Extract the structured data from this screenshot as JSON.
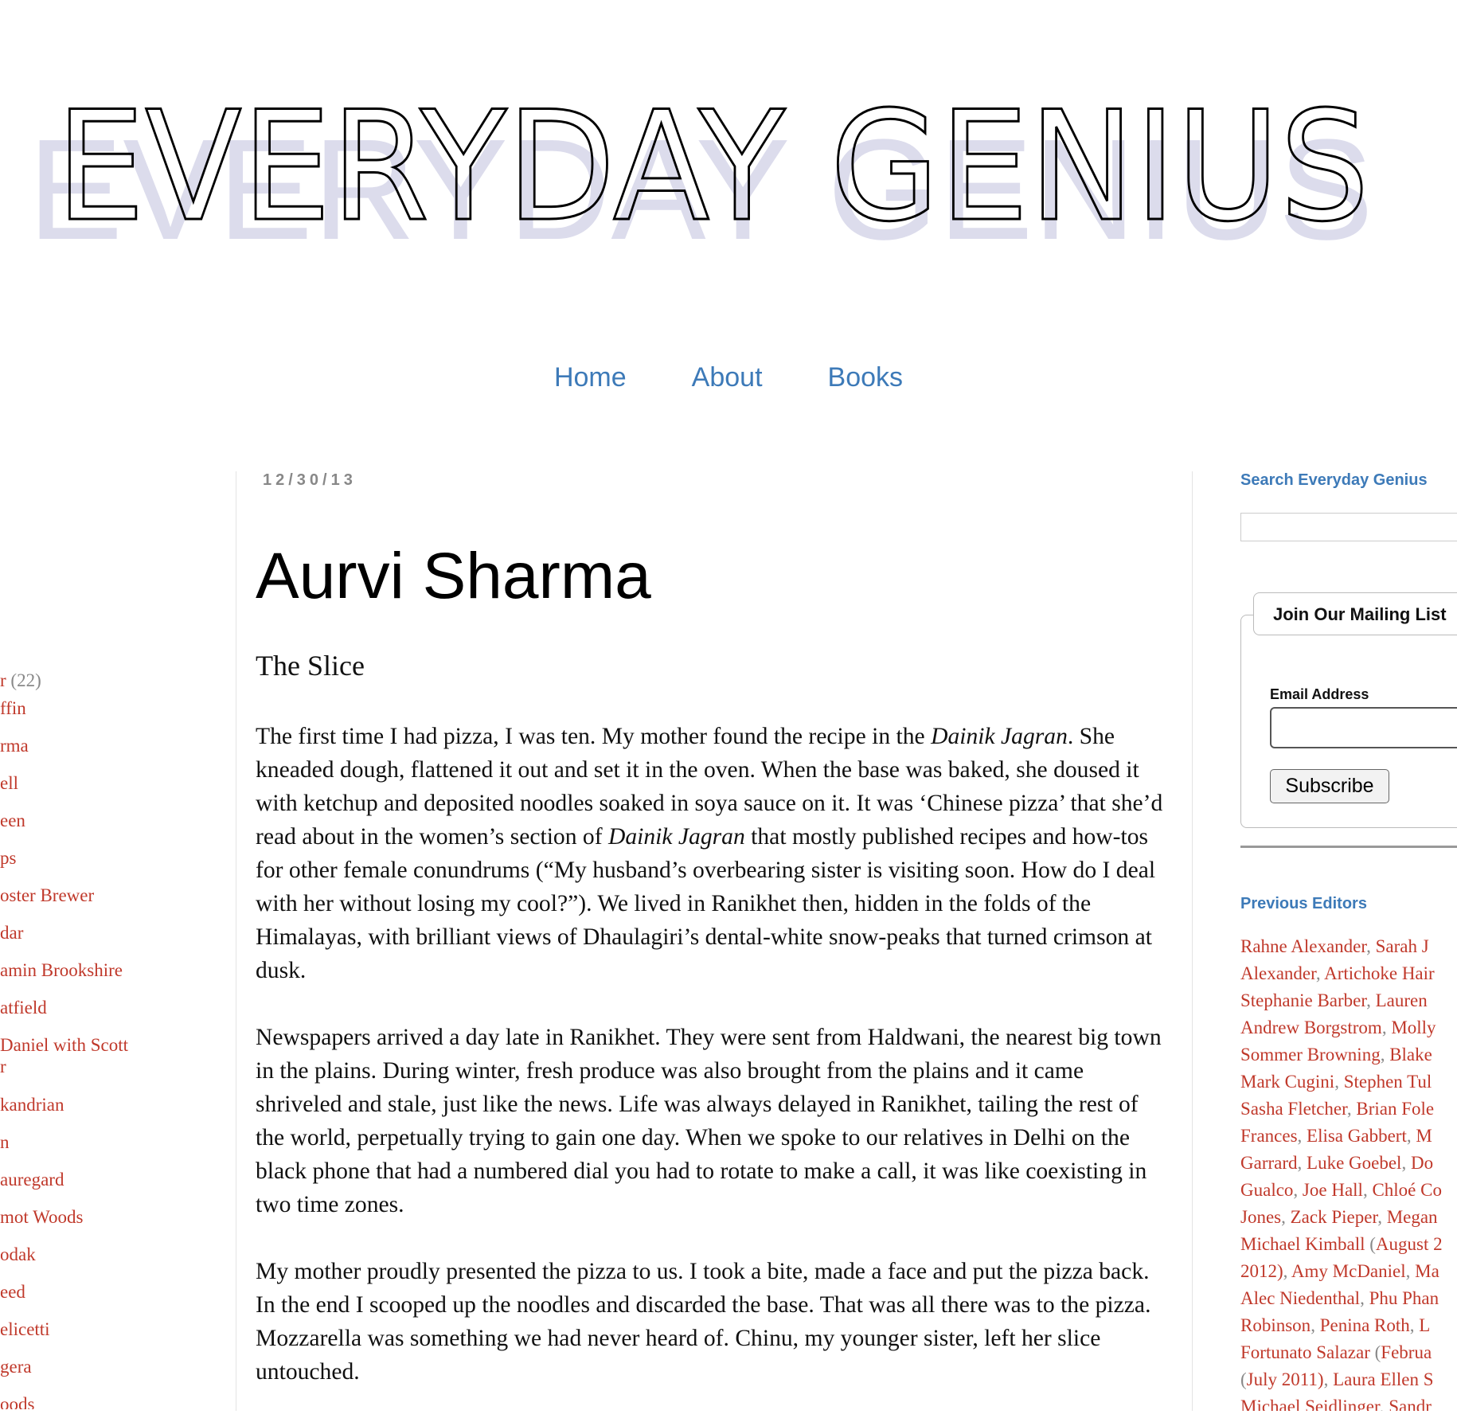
{
  "header": {
    "logo_text": "EVERYDAY GENIUS"
  },
  "nav": {
    "items": [
      "Home",
      "About",
      "Books"
    ]
  },
  "left_sidebar": {
    "first": {
      "label": "r",
      "count": "(22)"
    },
    "items": [
      "ffin",
      "rma",
      "ell",
      "een",
      "ps",
      "oster Brewer",
      "dar",
      "amin Brookshire",
      "atfield",
      "Daniel with Scott",
      "r",
      "kandrian",
      "n",
      "auregard",
      "mot Woods",
      "odak",
      "eed",
      "elicetti",
      "gera",
      "oods"
    ]
  },
  "post": {
    "date": "12/30/13",
    "title": "Aurvi Sharma",
    "subtitle": "The Slice",
    "p1": {
      "a": "The first time I had pizza, I was ten. My mother found the recipe in the ",
      "em1": "Dainik Jagran",
      "b": ". She kneaded dough, flattened it out and set it in the oven. When the base was baked, she doused it with ketchup and deposited noodles soaked in soya sauce on it. It was ‘Chinese pizza’ that she’d read about in the women’s section of ",
      "em2": "Dainik Jagran",
      "c": " that mostly published recipes and how-tos for other female conundrums (“My husband’s overbearing sister is visiting soon. How do I deal with her without losing my cool?”). We lived in Ranikhet then, hidden in the folds of the Himalayas, with brilliant views of Dhaulagiri’s dental-white snow-peaks that turned crimson at dusk."
    },
    "p2": "Newspapers arrived a day late in Ranikhet. They were sent from Haldwani, the nearest big town in the plains. During winter, fresh produce was also brought from the plains and it came shriveled and stale, just like the news. Life was always delayed in Ranikhet, tailing the rest of the world, perpetually trying to gain one day. When we spoke to our relatives in Delhi on the black phone that had a numbered dial you had to rotate to make a call, it was like coexisting in two time zones.",
    "p3": "My mother proudly presented the pizza to us. I took a bite, made a face and put the pizza back. In the end I scooped up the noodles and discarded the base. That was all there was to the pizza. Mozzarella was something we had never heard of. Chinu, my younger sister, left her slice untouched."
  },
  "right_sidebar": {
    "search_title": "Search Everyday Genius",
    "mailing_legend": "Join Our Mailing List",
    "email_label": "Email Address",
    "subscribe_label": "Subscribe",
    "editors_title": "Previous Editors",
    "editors_lines": [
      [
        {
          "t": "Rahne Alexander",
          "l": true
        },
        {
          "t": ", ",
          "l": false
        },
        {
          "t": "Sarah J",
          "l": true
        }
      ],
      [
        {
          "t": "Alexander",
          "l": true
        },
        {
          "t": ", ",
          "l": false
        },
        {
          "t": "Artichoke Hair",
          "l": true
        }
      ],
      [
        {
          "t": "Stephanie Barber",
          "l": true
        },
        {
          "t": ", ",
          "l": false
        },
        {
          "t": "Lauren",
          "l": true
        }
      ],
      [
        {
          "t": "Andrew Borgstrom",
          "l": true
        },
        {
          "t": ", ",
          "l": false
        },
        {
          "t": "Molly",
          "l": true
        }
      ],
      [
        {
          "t": "Sommer Browning",
          "l": true
        },
        {
          "t": ", ",
          "l": false
        },
        {
          "t": "Blake",
          "l": true
        }
      ],
      [
        {
          "t": "Mark Cugini",
          "l": true
        },
        {
          "t": ", ",
          "l": false
        },
        {
          "t": "Stephen Tul",
          "l": true
        }
      ],
      [
        {
          "t": "Sasha Fletcher",
          "l": true
        },
        {
          "t": ", ",
          "l": false
        },
        {
          "t": "Brian Fole",
          "l": true
        }
      ],
      [
        {
          "t": "Frances",
          "l": true
        },
        {
          "t": ", ",
          "l": false
        },
        {
          "t": "Elisa Gabbert",
          "l": true
        },
        {
          "t": ", ",
          "l": false
        },
        {
          "t": "M",
          "l": true
        }
      ],
      [
        {
          "t": "Garrard",
          "l": true
        },
        {
          "t": ", ",
          "l": false
        },
        {
          "t": "Luke Goebel",
          "l": true
        },
        {
          "t": ", ",
          "l": false
        },
        {
          "t": "Do",
          "l": true
        }
      ],
      [
        {
          "t": "Gualco",
          "l": true
        },
        {
          "t": ", ",
          "l": false
        },
        {
          "t": "Joe Hall",
          "l": true
        },
        {
          "t": ", ",
          "l": false
        },
        {
          "t": "Chloé Co",
          "l": true
        }
      ],
      [
        {
          "t": "Jones",
          "l": true
        },
        {
          "t": ", ",
          "l": false
        },
        {
          "t": "Zack Pieper",
          "l": true
        },
        {
          "t": ", ",
          "l": false
        },
        {
          "t": "Megan",
          "l": true
        }
      ],
      [
        {
          "t": "Michael Kimball",
          "l": true
        },
        {
          "t": " (",
          "l": false
        },
        {
          "t": "August 2",
          "l": true
        }
      ],
      [
        {
          "t": "2012)",
          "l": true
        },
        {
          "t": ", ",
          "l": false
        },
        {
          "t": "Amy McDaniel",
          "l": true
        },
        {
          "t": ", ",
          "l": false
        },
        {
          "t": "Ma",
          "l": true
        }
      ],
      [
        {
          "t": "Alec Niedenthal",
          "l": true
        },
        {
          "t": ", ",
          "l": false
        },
        {
          "t": "Phu Phan",
          "l": true
        }
      ],
      [
        {
          "t": "Robinson",
          "l": true
        },
        {
          "t": ", ",
          "l": false
        },
        {
          "t": "Penina Roth",
          "l": true
        },
        {
          "t": ", ",
          "l": false
        },
        {
          "t": "L",
          "l": true
        }
      ],
      [
        {
          "t": "Fortunato Salazar",
          "l": true
        },
        {
          "t": " (",
          "l": false
        },
        {
          "t": "Februa",
          "l": true
        }
      ],
      [
        {
          "t": "(",
          "l": false
        },
        {
          "t": "July 2011)",
          "l": true
        },
        {
          "t": ", ",
          "l": false
        },
        {
          "t": "Laura Ellen S",
          "l": true
        }
      ],
      [
        {
          "t": "Michael Seidlinger",
          "l": true
        },
        {
          "t": ", ",
          "l": false
        },
        {
          "t": "Sandr",
          "l": true
        }
      ]
    ]
  },
  "colors": {
    "link_blue": "#3d7ab8",
    "link_red": "#c0392b",
    "logo_shadow": "#dcdcec",
    "muted": "#888888"
  },
  "icons": []
}
